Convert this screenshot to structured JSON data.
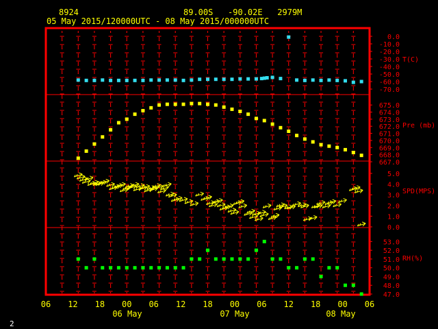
{
  "header": {
    "station_id": "8924",
    "location": "89.00S   -90.02E   2979M",
    "time_range": "05 May 2015/120000UTC - 08 May 2015/000000UTC"
  },
  "footer": {
    "page_number": "2"
  },
  "chart_data": {
    "type": "scatter",
    "colors": {
      "frame": "#ff0000",
      "grid": "#ff0000",
      "axis_text": "#ffff00",
      "panel_text": "#ff0000",
      "temperature": "#33ddee",
      "pressure": "#ffff00",
      "wind": "#ffff00",
      "rh": "#00ff00"
    },
    "x_axis": {
      "tick_labels": [
        "06",
        "12",
        "18",
        "00",
        "06",
        "12",
        "18",
        "00",
        "06",
        "12",
        "18",
        "00",
        "06"
      ],
      "day_labels": [
        "06 May",
        "07 May",
        "08 May"
      ]
    },
    "panels": [
      {
        "name": "temperature",
        "label": "T(C)",
        "yticks": [
          "0.0",
          "-10.0",
          "-20.0",
          "-30.0",
          "-40.0",
          "-50.0",
          "-60.0",
          "-70.0"
        ],
        "ymax": 0,
        "ymin": -70,
        "x": [
          12,
          15,
          18,
          21,
          24,
          27,
          30,
          33,
          36,
          39,
          42,
          45,
          48,
          51,
          54,
          57,
          60,
          63,
          66,
          69,
          72,
          75,
          78,
          80,
          81,
          82,
          84,
          87,
          90,
          93,
          96,
          99,
          102,
          105,
          108,
          111,
          114,
          117
        ],
        "y": [
          -58.0,
          -58.5,
          -58.5,
          -58.0,
          -58.5,
          -58.5,
          -58.5,
          -58.5,
          -58.5,
          -58.0,
          -58.0,
          -58.0,
          -58.0,
          -58.5,
          -58.0,
          -57.0,
          -57.0,
          -57.0,
          -57.0,
          -57.0,
          -56.5,
          -56.5,
          -56.5,
          -56.0,
          -55.5,
          -55.0,
          -54.5,
          -56.0,
          -1.0,
          -58.0,
          -58.5,
          -58.0,
          -58.5,
          -58.0,
          -58.5,
          -59.0,
          -61.0,
          -60.0
        ]
      },
      {
        "name": "pressure",
        "label": "Pre (mb)",
        "yticks": [
          "675.0",
          "674.0",
          "673.0",
          "672.0",
          "671.0",
          "670.0",
          "669.0",
          "668.0",
          "667.0"
        ],
        "ymax": 675.5,
        "ymin": 667.0,
        "x": [
          12,
          15,
          18,
          21,
          24,
          27,
          30,
          33,
          36,
          39,
          42,
          45,
          48,
          51,
          54,
          57,
          60,
          63,
          66,
          69,
          72,
          75,
          78,
          81,
          84,
          87,
          90,
          93,
          96,
          99,
          102,
          105,
          108,
          111,
          114,
          117
        ],
        "y": [
          667.5,
          668.5,
          669.5,
          670.5,
          671.5,
          672.5,
          673.0,
          673.7,
          674.2,
          674.6,
          675.0,
          675.1,
          675.1,
          675.1,
          675.2,
          675.2,
          675.1,
          675.0,
          674.7,
          674.4,
          674.1,
          673.7,
          673.1,
          672.8,
          672.3,
          671.8,
          671.3,
          670.7,
          670.2,
          669.8,
          669.4,
          669.2,
          669.0,
          668.7,
          668.3,
          667.9
        ]
      },
      {
        "name": "wind_speed",
        "label": "SPD(MPS)",
        "yticks": [
          "5.0",
          "4.0",
          "3.0",
          "2.0",
          "1.0",
          "0.0"
        ],
        "ymax": 5.0,
        "ymin": 0.0,
        "x": [
          12,
          13,
          14,
          15,
          16,
          17,
          18,
          19,
          20,
          21,
          22,
          24,
          25,
          26,
          27,
          28,
          29,
          30,
          31,
          32,
          33,
          34,
          35,
          36,
          37,
          38,
          39,
          40,
          41,
          42,
          43,
          44,
          45,
          46,
          47,
          48,
          49,
          51,
          53,
          55,
          57,
          59,
          60,
          61,
          62,
          63,
          64,
          65,
          66,
          67,
          68,
          69,
          70,
          71,
          72,
          73,
          75,
          76,
          77,
          78,
          79,
          80,
          81,
          82,
          84,
          85,
          86,
          87,
          88,
          90,
          91,
          93,
          95,
          96,
          97,
          99,
          100,
          101,
          102,
          104,
          105,
          106,
          108,
          110,
          114,
          115,
          116,
          117
        ],
        "y": [
          4.8,
          4.6,
          4.4,
          4.2,
          4.5,
          4.0,
          4.1,
          4.0,
          4.0,
          4.1,
          4.2,
          3.9,
          3.6,
          3.7,
          3.8,
          3.9,
          3.4,
          3.6,
          3.8,
          3.7,
          3.9,
          3.5,
          3.8,
          3.6,
          3.7,
          3.4,
          3.6,
          3.5,
          3.8,
          3.7,
          3.3,
          3.6,
          3.9,
          3.0,
          2.9,
          2.5,
          2.6,
          2.5,
          2.3,
          2.1,
          3.0,
          2.6,
          2.7,
          2.2,
          2.0,
          2.3,
          2.4,
          2.0,
          1.7,
          1.8,
          1.9,
          1.5,
          1.3,
          2.2,
          2.3,
          1.9,
          1.2,
          1.4,
          0.9,
          1.2,
          0.7,
          1.3,
          1.1,
          1.9,
          0.8,
          1.0,
          1.7,
          2.0,
          1.9,
          1.8,
          1.8,
          2.1,
          2.0,
          1.9,
          0.7,
          0.8,
          1.9,
          1.9,
          2.2,
          1.9,
          2.2,
          2.3,
          2.0,
          2.4,
          3.5,
          3.6,
          3.3,
          0.2
        ]
      },
      {
        "name": "rh",
        "label": "RH(%)",
        "yticks": [
          "53.0",
          "52.0",
          "51.0",
          "50.0",
          "49.0",
          "48.0",
          "47.0"
        ],
        "ymax": 53.5,
        "ymin": 47.0,
        "x": [
          12,
          15,
          18,
          21,
          24,
          27,
          30,
          33,
          36,
          39,
          42,
          45,
          48,
          51,
          54,
          57,
          60,
          63,
          66,
          69,
          72,
          75,
          78,
          81,
          84,
          87,
          90,
          93,
          96,
          99,
          102,
          105,
          108,
          111,
          114,
          117
        ],
        "y": [
          51.0,
          50.0,
          51.0,
          50.0,
          50.0,
          50.0,
          50.0,
          50.0,
          50.0,
          50.0,
          50.0,
          50.0,
          50.0,
          50.0,
          51.0,
          51.0,
          52.0,
          51.0,
          51.0,
          51.0,
          51.0,
          51.0,
          52.0,
          53.0,
          51.0,
          51.0,
          50.0,
          50.0,
          51.0,
          51.0,
          49.0,
          50.0,
          50.0,
          48.0,
          48.0,
          47.0
        ]
      }
    ]
  }
}
